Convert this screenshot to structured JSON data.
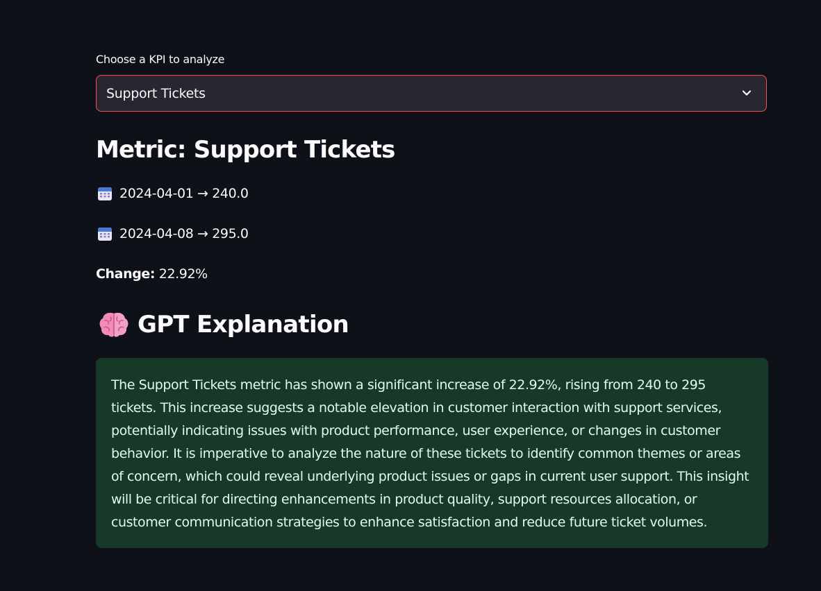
{
  "selector": {
    "label": "Choose a KPI to analyze",
    "selected": "Support Tickets",
    "border_color": "#ff4b4b"
  },
  "metric": {
    "title": "Metric: Support Tickets",
    "rows": [
      {
        "icon": "calendar-icon",
        "text": "2024-04-01 → 240.0"
      },
      {
        "icon": "calendar-icon",
        "text": "2024-04-08 → 295.0"
      }
    ],
    "change_label": "Change:",
    "change_value": "22.92%"
  },
  "gpt": {
    "icon": "brain-icon",
    "title": "GPT Explanation",
    "explanation": "The Support Tickets metric has shown a significant increase of 22.92%, rising from 240 to 295 tickets. This increase suggests a notable elevation in customer interaction with support services, potentially indicating issues with product performance, user experience, or changes in customer behavior. It is imperative to analyze the nature of these tickets to identify common themes or areas of concern, which could reveal underlying product issues or gaps in current user support. This insight will be critical for directing enhancements in product quality, support resources allocation, or customer communication strategies to enhance satisfaction and reduce future ticket volumes.",
    "box_color": "#173928",
    "text_color": "#dffde9"
  },
  "theme": {
    "background": "#0e1117",
    "text": "#fafafa",
    "select_background": "#262730"
  }
}
